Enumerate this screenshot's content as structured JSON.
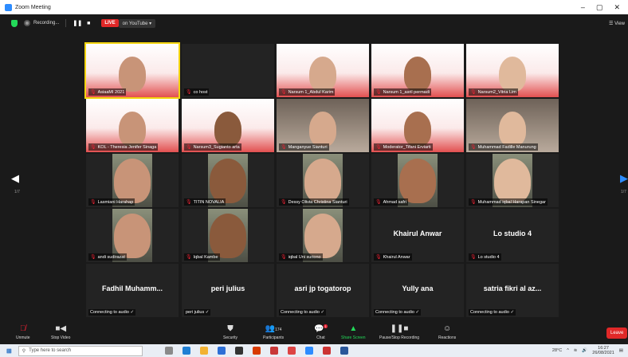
{
  "window": {
    "title": "Zoom Meeting",
    "controls": [
      "–",
      "▢",
      "✕"
    ]
  },
  "top_toolbar": {
    "recording_label": "Recording...",
    "live_label": "LIVE",
    "stream_label": "on YouTube ▾",
    "view_label": "☰ View"
  },
  "colors": {
    "accent": "#2d8cff",
    "live": "#e02828",
    "active_speaker": "#f3d40e",
    "mic_muted": "#e22233"
  },
  "participants": [
    {
      "name": "AsiaaMI 2021",
      "kind": "video",
      "style": "pinkred"
    },
    {
      "name": "co host",
      "kind": "video",
      "style": "dark"
    },
    {
      "name": "Narsum 1_Abdul Karim",
      "kind": "video",
      "style": "pinkred"
    },
    {
      "name": "Narsum 1_asril permadi",
      "kind": "video",
      "style": "pinkred"
    },
    {
      "name": "Narsum2_Vitria Lim",
      "kind": "video",
      "style": "pinkred"
    },
    {
      "name": "KOL - Theresia Jenifer Sinaga",
      "kind": "video",
      "style": "pinkred"
    },
    {
      "name": "Narsum3_Sugianto arta",
      "kind": "video",
      "style": "pinkred"
    },
    {
      "name": "Manganyue Sianturi",
      "kind": "video",
      "style": "room"
    },
    {
      "name": "Moderator_Tifani Erviarti",
      "kind": "video",
      "style": "pinkred"
    },
    {
      "name": "Muhammad Fadille Manurung",
      "kind": "video",
      "style": "room"
    },
    {
      "name": "Lasmiani Harahap",
      "kind": "video",
      "style": "dark"
    },
    {
      "name": "TITIN NOVALIA",
      "kind": "video",
      "style": "dark"
    },
    {
      "name": "Dessy Olivia Christina Sianturi",
      "kind": "video",
      "style": "dark"
    },
    {
      "name": "Ahmad safri",
      "kind": "video",
      "style": "dark"
    },
    {
      "name": "Muhammad iqbal Harapan Sinegar",
      "kind": "video",
      "style": "dark"
    },
    {
      "name": "andi sudirazat",
      "kind": "video",
      "style": "dark"
    },
    {
      "name": "Iqbal Kambe",
      "kind": "video",
      "style": "dark"
    },
    {
      "name": "iqbal Uni suriono",
      "kind": "video",
      "style": "dark"
    },
    {
      "name": "Khairul Anwar",
      "display": "Khairul Anwar",
      "kind": "text"
    },
    {
      "name": "Lo studio 4",
      "display": "Lo studio 4",
      "kind": "text"
    },
    {
      "name": "Connecting to audio ✓",
      "display": "Fadhil Muhamm...",
      "kind": "text"
    },
    {
      "name": "peri julius ✓",
      "display": "peri julius",
      "kind": "text"
    },
    {
      "name": "Connecting to audio ✓",
      "display": "asri jp togatorop",
      "kind": "text"
    },
    {
      "name": "Connecting to audio ✓",
      "display": "Yully ana",
      "kind": "text"
    },
    {
      "name": "Connecting to audio ✓",
      "display": "satria fikri al az...",
      "kind": "text"
    }
  ],
  "pager": {
    "left_page": "1/7",
    "right_page": "1/7"
  },
  "bottom_toolbar": {
    "unmute": "Unmute",
    "stop_video": "Stop Video",
    "security": "Security",
    "participants": "Participants",
    "participant_count": "174",
    "chat": "Chat",
    "chat_badge": "1",
    "share_screen": "Share Screen",
    "pause_recording": "Pause/Stop Recording",
    "reactions": "Reactions",
    "leave": "Leave"
  },
  "taskbar": {
    "search_placeholder": "Type here to search",
    "temperature": "28°C",
    "time": "16:27",
    "date": "26/08/2021"
  }
}
